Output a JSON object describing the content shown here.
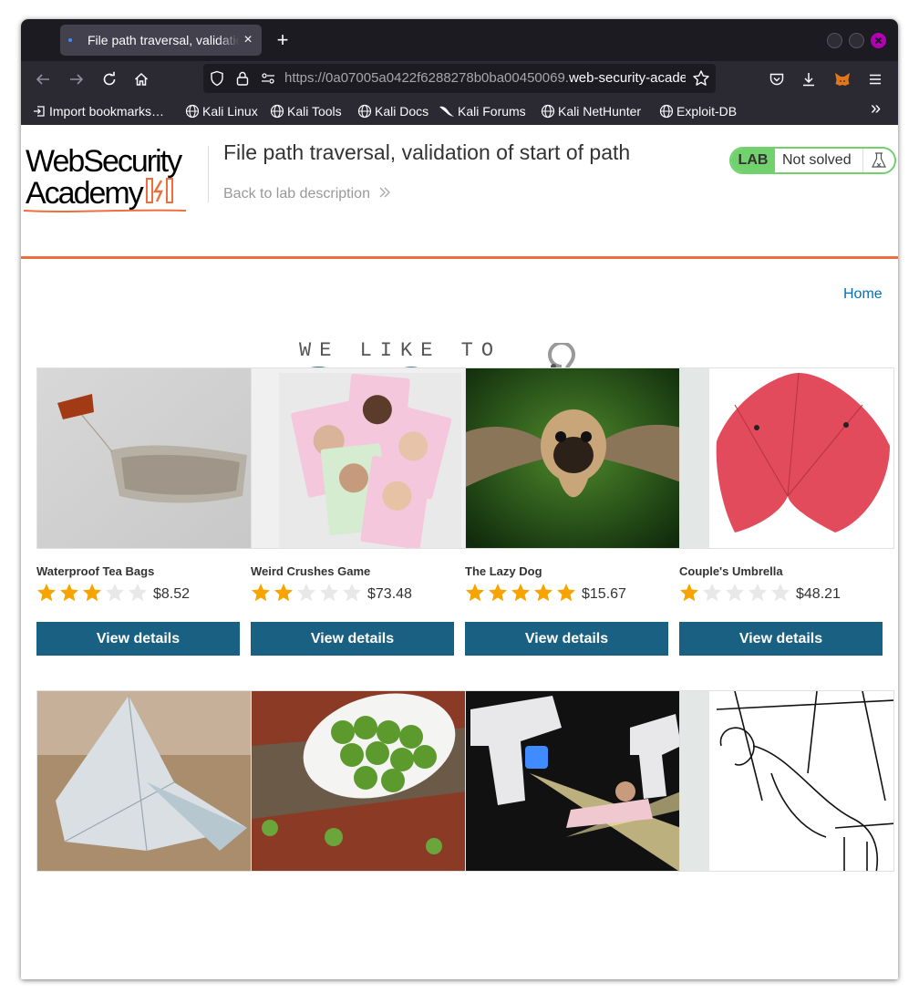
{
  "browser": {
    "tab_title": "File path traversal, validation of start of path",
    "tab_close": "×",
    "new_tab": "+",
    "url_prefix": "https://0a07005a0422f6288278b0ba00450069.",
    "url_host": "web-security-academy.net/",
    "bookmarks": [
      {
        "label": "Import bookmarks…",
        "icon": "import-icon"
      },
      {
        "label": "Kali Linux",
        "icon": "globe-icon"
      },
      {
        "label": "Kali Tools",
        "icon": "globe-icon"
      },
      {
        "label": "Kali Docs",
        "icon": "globe-icon"
      },
      {
        "label": "Kali Forums",
        "icon": "dragon-icon"
      },
      {
        "label": "Kali NetHunter",
        "icon": "globe-icon"
      },
      {
        "label": "Exploit-DB",
        "icon": "globe-icon"
      }
    ],
    "overflow": "»"
  },
  "header": {
    "logo_line1": "WebSecurity",
    "logo_line2": "Academy",
    "lab_title": "File path traversal, validation of start of path",
    "back_link": "Back to lab description",
    "status_badge": "LAB",
    "status_text": "Not solved"
  },
  "nav": {
    "home": "Home"
  },
  "shop_logo": {
    "tagline": "WE LIKE TO",
    "word": "SHOP"
  },
  "colors": {
    "accent": "#ee6f3d",
    "button": "#1a6083",
    "status_green": "#70d16d",
    "star": "#f7a400",
    "star_empty": "#e8e8e8",
    "link": "#0071bc"
  },
  "products": [
    {
      "name": "Waterproof Tea Bags",
      "rating": 3,
      "price": "$8.52",
      "button": "View details"
    },
    {
      "name": "Weird Crushes Game",
      "rating": 2,
      "price": "$73.48",
      "button": "View details"
    },
    {
      "name": "The Lazy Dog",
      "rating": 5,
      "price": "$15.67",
      "button": "View details"
    },
    {
      "name": "Couple's Umbrella",
      "rating": 1,
      "price": "$48.21",
      "button": "View details"
    }
  ]
}
